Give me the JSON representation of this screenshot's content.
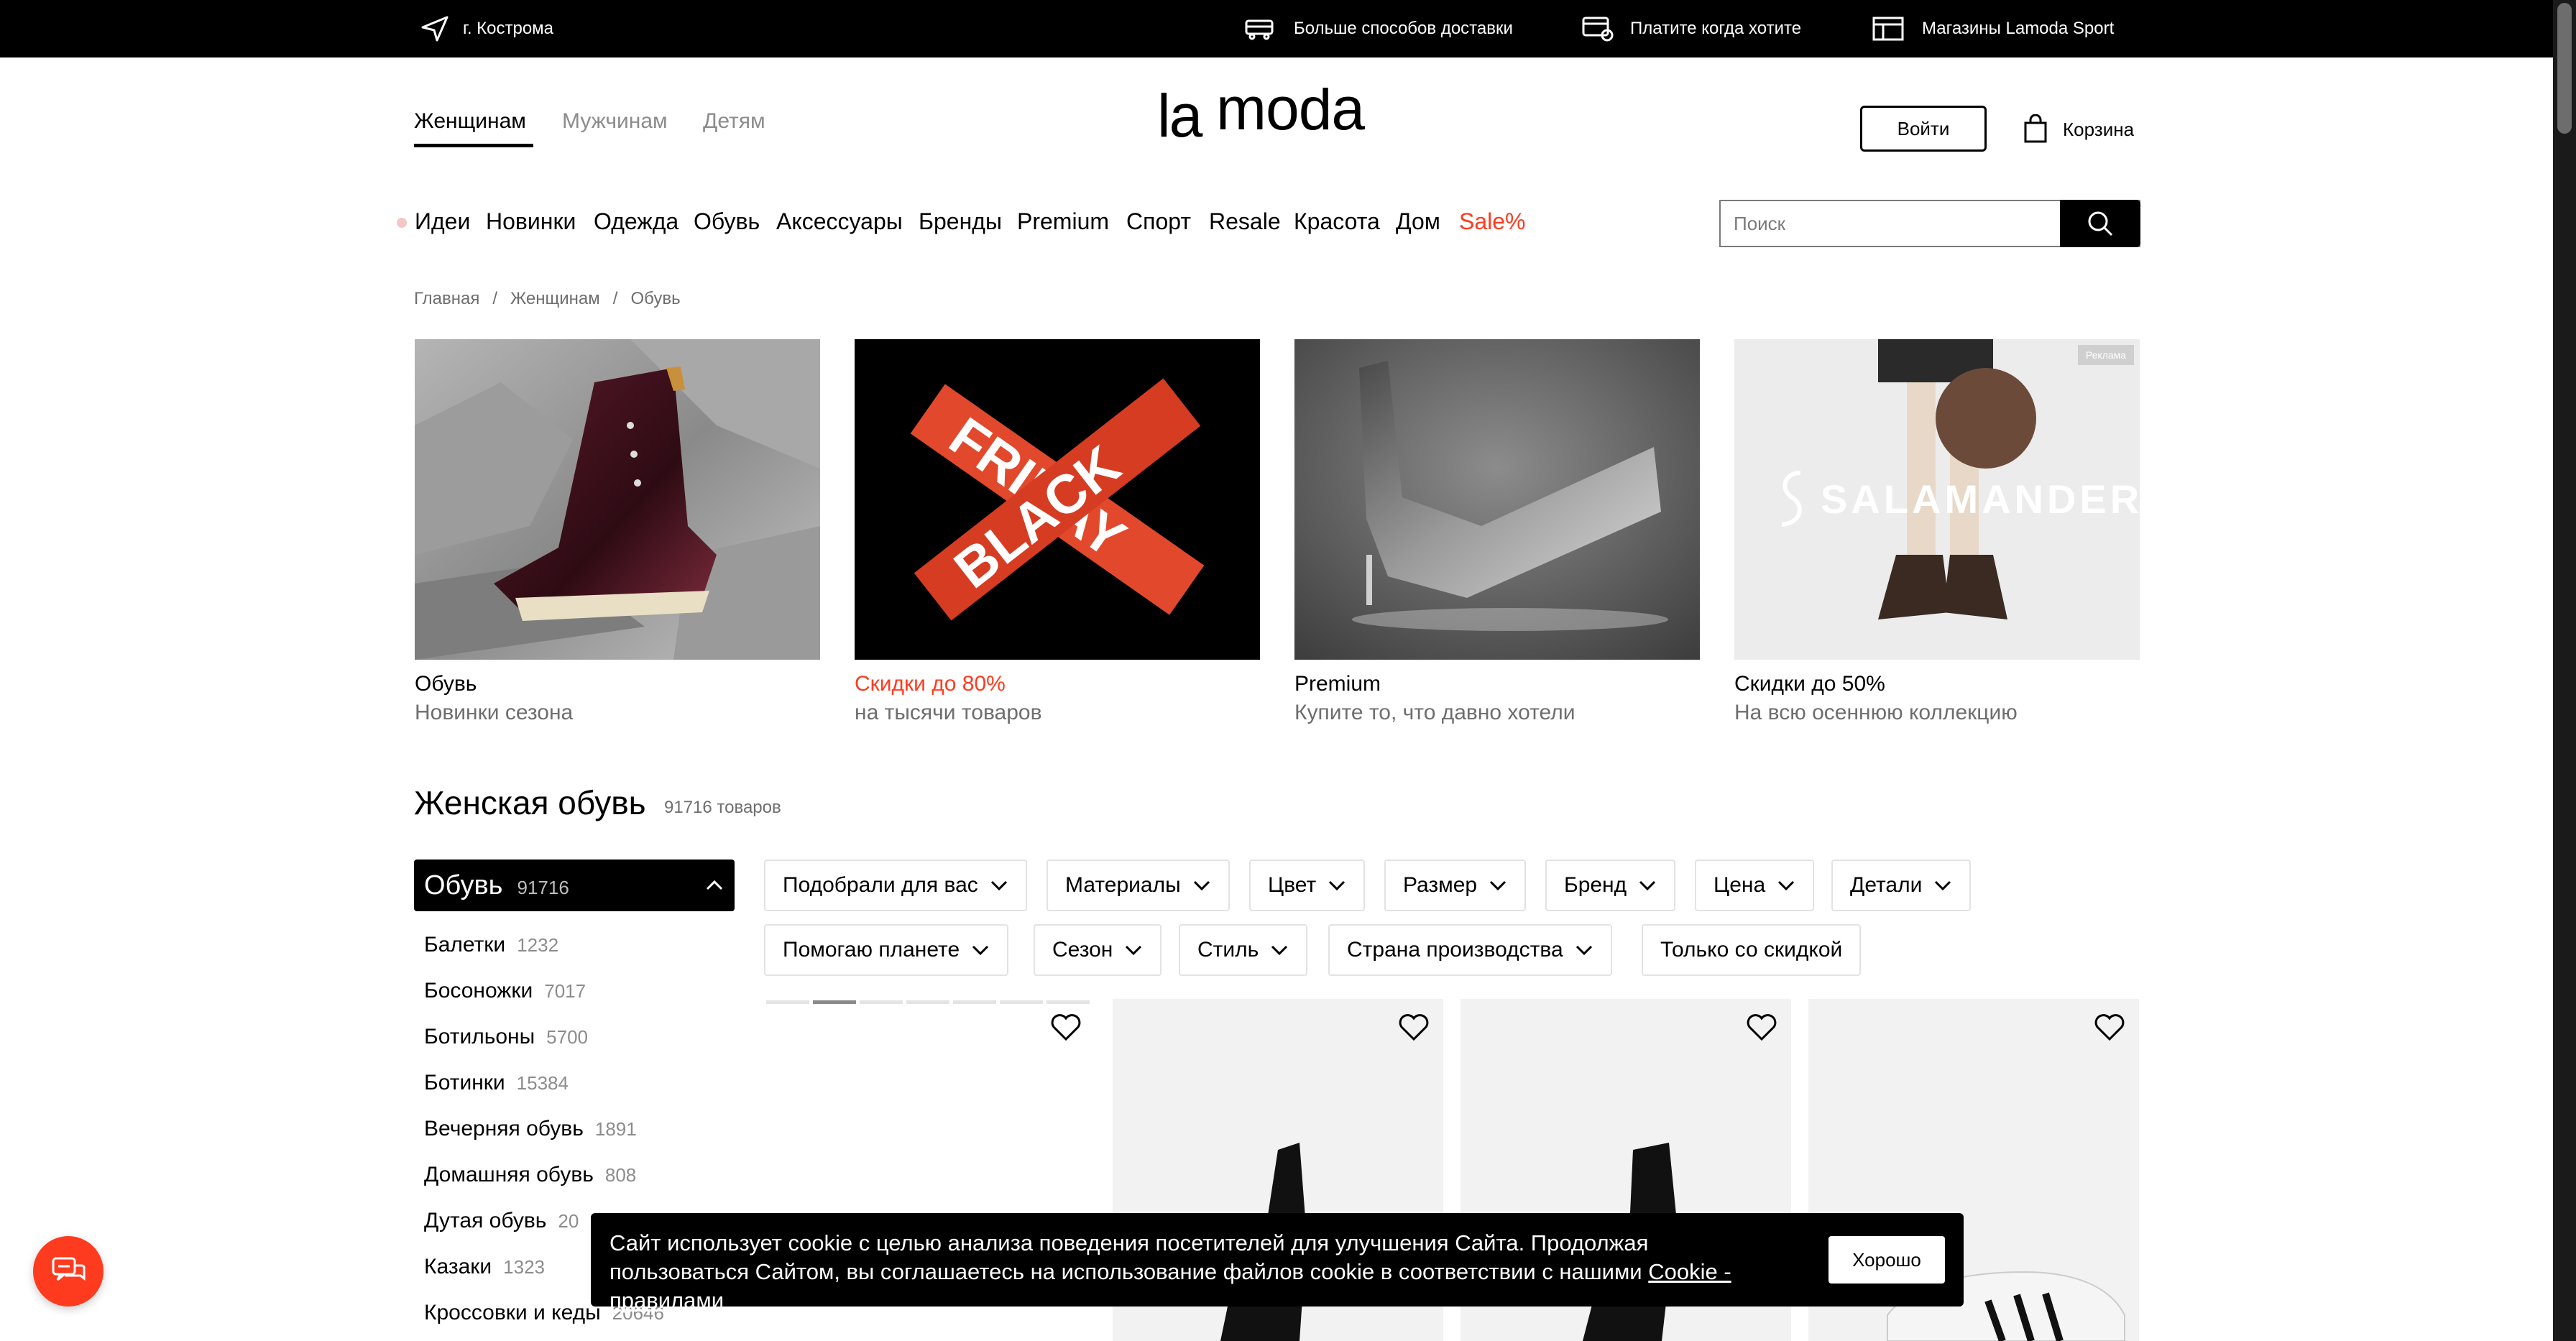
{
  "topbar": {
    "city": "г. Кострома",
    "delivery": "Больше способов доставки",
    "pay": "Платите когда хотите",
    "stores": "Магазины Lamoda Sport"
  },
  "header": {
    "genders": [
      "Женщинам",
      "Мужчинам",
      "Детям"
    ],
    "logo": "lamoda",
    "login": "Войти",
    "cart": "Корзина"
  },
  "nav": {
    "items": [
      "Идеи",
      "Новинки",
      "Одежда",
      "Обувь",
      "Аксессуары",
      "Бренды",
      "Premium",
      "Спорт",
      "Resale",
      "Красота",
      "Дом",
      "Sale%"
    ],
    "search_placeholder": "Поиск"
  },
  "breadcrumb": [
    "Главная",
    "Женщинам",
    "Обувь"
  ],
  "breadcrumb_separator": "/",
  "promos": [
    {
      "title": "Обувь",
      "subtitle": "Новинки сезона"
    },
    {
      "title": "Скидки до 80%",
      "subtitle": "на тысячи товаров",
      "image_text": "FRIDAY BLACK"
    },
    {
      "title": "Premium",
      "subtitle": "Купите то, что давно хотели"
    },
    {
      "title": "Скидки до 50%",
      "subtitle": "На всю осеннюю коллекцию",
      "badge": "Реклама",
      "brand": "SALAMANDER"
    }
  ],
  "section": {
    "title": "Женская обувь",
    "count": "91716 товаров"
  },
  "sidebar": {
    "header": {
      "name": "Обувь",
      "count": "91716"
    },
    "categories": [
      {
        "name": "Балетки",
        "count": "1232"
      },
      {
        "name": "Босоножки",
        "count": "7017"
      },
      {
        "name": "Ботильоны",
        "count": "5700"
      },
      {
        "name": "Ботинки",
        "count": "15384"
      },
      {
        "name": "Вечерняя обувь",
        "count": "1891"
      },
      {
        "name": "Домашняя обувь",
        "count": "808"
      },
      {
        "name": "Дутая обувь",
        "count": "20"
      },
      {
        "name": "Казаки",
        "count": "1323"
      },
      {
        "name": "Кроссовки и кеды",
        "count": "20646"
      }
    ]
  },
  "filters": {
    "row1": [
      "Подобрали для вас",
      "Материалы",
      "Цвет",
      "Размер",
      "Бренд",
      "Цена",
      "Детали"
    ],
    "row2": [
      "Помогаю планете",
      "Сезон",
      "Стиль",
      "Страна производства",
      "Только со скидкой"
    ]
  },
  "cookie": {
    "text": "Сайт использует cookie с целью анализа поведения посетителей для улучшения Сайта. Продолжая пользоваться Сайтом, вы соглашаетесь на использование файлов cookie в соответствии с нашими",
    "link": "Cookie - правилами",
    "button": "Хорошо"
  },
  "colors": {
    "sale": "#ff3b1f",
    "chat": "#ff3b1f"
  },
  "icons": [
    "location-arrow-icon",
    "truck-icon",
    "card-icon",
    "store-icon",
    "bag-icon",
    "search-icon",
    "chevron-down-icon",
    "chevron-up-icon",
    "heart-icon",
    "chat-icon"
  ]
}
